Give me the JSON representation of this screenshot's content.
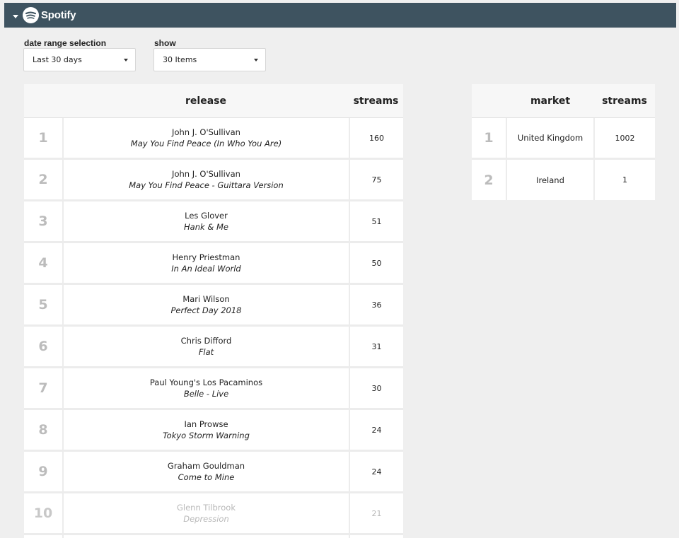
{
  "header": {
    "brand": "Spotify"
  },
  "controls": {
    "date_range": {
      "label": "date range selection",
      "value": "Last 30 days"
    },
    "show": {
      "label": "show",
      "value": "30 Items"
    }
  },
  "releases_table": {
    "columns": {
      "release": "release",
      "streams": "streams"
    },
    "rows": [
      {
        "rank": "1",
        "artist": "John J. O'Sullivan",
        "title": "May You Find Peace (In Who You Are)",
        "streams": "160"
      },
      {
        "rank": "2",
        "artist": "John J. O'Sullivan",
        "title": "May You Find Peace - Guittara Version",
        "streams": "75"
      },
      {
        "rank": "3",
        "artist": "Les Glover",
        "title": "Hank & Me",
        "streams": "51"
      },
      {
        "rank": "4",
        "artist": "Henry Priestman",
        "title": "In An Ideal World",
        "streams": "50"
      },
      {
        "rank": "5",
        "artist": "Mari Wilson",
        "title": "Perfect Day 2018",
        "streams": "36"
      },
      {
        "rank": "6",
        "artist": "Chris Difford",
        "title": "Flat",
        "streams": "31"
      },
      {
        "rank": "7",
        "artist": "Paul Young's Los Pacaminos",
        "title": "Belle - Live",
        "streams": "30"
      },
      {
        "rank": "8",
        "artist": "Ian Prowse",
        "title": "Tokyo Storm Warning",
        "streams": "24"
      },
      {
        "rank": "9",
        "artist": "Graham Gouldman",
        "title": "Come to Mine",
        "streams": "24"
      },
      {
        "rank": "10",
        "artist": "Glenn Tilbrook",
        "title": "Depression",
        "streams": "21"
      }
    ]
  },
  "markets_table": {
    "columns": {
      "market": "market",
      "streams": "streams"
    },
    "rows": [
      {
        "rank": "1",
        "market": "United Kingdom",
        "streams": "1002"
      },
      {
        "rank": "2",
        "market": "Ireland",
        "streams": "1"
      }
    ]
  }
}
